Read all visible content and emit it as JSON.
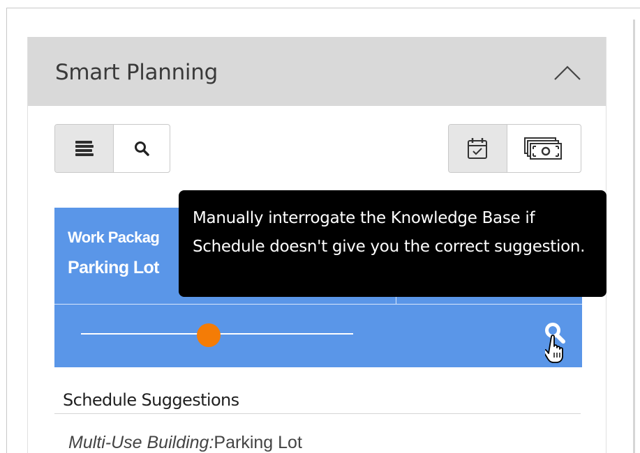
{
  "panel": {
    "title": "Smart Planning",
    "collapse_icon": "chevron-up-icon"
  },
  "toolbar": {
    "left_group": [
      {
        "icon": "list-stack-icon",
        "active": true
      },
      {
        "icon": "search-icon",
        "active": false
      }
    ],
    "right_group": [
      {
        "icon": "calendar-check-icon",
        "active": true
      },
      {
        "icon": "money-bills-icon",
        "active": false
      }
    ]
  },
  "work_package": {
    "label": "Work Packag",
    "value": "Parking Lot",
    "slider_level": 0.47,
    "search_icon": "search-icon",
    "cursor_icon": "hand-pointer-icon",
    "color": "#5a96e8",
    "thumb_color": "#f47c06"
  },
  "tooltip": {
    "text": "Manually interrogate the Knowledge Base if Schedule doesn't give you the correct suggestion."
  },
  "suggestions": {
    "title": "Schedule Suggestions",
    "items": [
      {
        "project": "Multi-Use Building:",
        "name": "Parking Lot"
      }
    ]
  }
}
